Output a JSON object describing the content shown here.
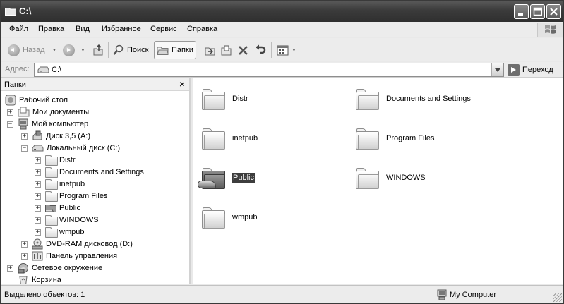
{
  "window": {
    "title": "C:\\",
    "icons": {
      "folder": "folder-icon",
      "minimize": "minimize-icon",
      "maximize": "maximize-icon",
      "close": "close-icon"
    }
  },
  "menu": {
    "file": {
      "hot": "Ф",
      "rest": "айл"
    },
    "edit": {
      "hot": "П",
      "rest": "равка"
    },
    "view": {
      "hot": "В",
      "rest": "ид"
    },
    "favorites": {
      "hot": "И",
      "rest": "збранное"
    },
    "tools": {
      "hot": "С",
      "rest": "ервис"
    },
    "help": {
      "hot": "С",
      "rest": "правка"
    }
  },
  "toolbar": {
    "back_label": "Назад",
    "search_label": "Поиск",
    "folders_label": "Папки"
  },
  "address": {
    "label": "Адрес:",
    "value": "C:\\",
    "go_label": "Переход"
  },
  "tree": {
    "title": "Папки",
    "close": "×",
    "nodes": {
      "desktop": "Рабочий стол",
      "mydocs": "Мои документы",
      "mycomputer": "Мой компьютер",
      "floppy": "Диск 3,5 (A:)",
      "local_c": "Локальный диск (C:)",
      "distr": "Distr",
      "docs_settings": "Documents and Settings",
      "inetpub": "inetpub",
      "program_files": "Program Files",
      "public": "Public",
      "windows": "WINDOWS",
      "wmpub": "wmpub",
      "dvd": "DVD-RAM дисковод (D:)",
      "control_panel": "Панель управления",
      "network": "Сетевое окружение",
      "recycle": "Корзина"
    }
  },
  "content": {
    "items": {
      "distr": "Distr",
      "docs_settings": "Documents and Settings",
      "inetpub": "inetpub",
      "program_files": "Program Files",
      "public": "Public",
      "windows": "WINDOWS",
      "wmpub": "wmpub"
    },
    "selected": "Public"
  },
  "status": {
    "left": "Выделено объектов: 1",
    "right": "My Computer"
  },
  "colors": {
    "titlebar": "#3b3b3b",
    "selection": "#3d3d3d"
  }
}
